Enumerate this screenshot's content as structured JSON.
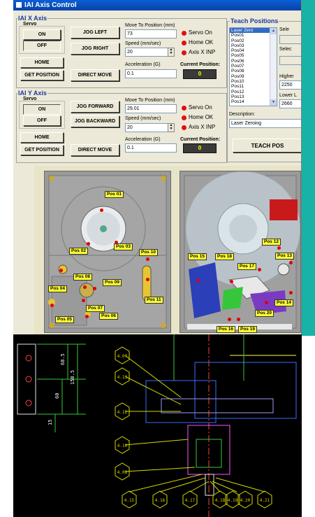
{
  "window": {
    "title": "IAI Axis Control"
  },
  "x_axis": {
    "group_title": "IAI X Axis",
    "servo_label": "Servo",
    "on_label": "ON",
    "off_label": "OFF",
    "home_label": "HOME",
    "get_position_label": "GET POSITION",
    "jog_a_label": "JOG LEFT",
    "jog_b_label": "JOG RIGHT",
    "direct_move_label": "DIRECT MOVE",
    "move_to_label": "Move To Position (mm)",
    "move_to_value": "73",
    "speed_label": "Speed (mm/sec)",
    "speed_value": "20",
    "accel_label": "Acceleration (G)",
    "accel_value": "0.1",
    "servo_on": "Servo On",
    "home_ok": "Home OK",
    "inp": "Axis X INP",
    "current_pos_label": "Current Position:",
    "current_pos_value": "0"
  },
  "y_axis": {
    "group_title": "IAI Y Axis",
    "servo_label": "Servo",
    "on_label": "ON",
    "off_label": "OFF",
    "home_label": "HOME",
    "get_position_label": "GET POSITION",
    "jog_a_label": "JOG FORWARD",
    "jog_b_label": "JOG BACKWARD",
    "direct_move_label": "DIRECT MOVE",
    "move_to_label": "Move To Position (mm)",
    "move_to_value": "29.01",
    "speed_label": "Speed (mm/sec)",
    "speed_value": "20",
    "accel_label": "Acceleration (G)",
    "accel_value": "0.1",
    "servo_on": "Servo On",
    "home_ok": "Home OK",
    "inp": "Axis X INP",
    "current_pos_label": "Current Position:",
    "current_pos_value": "0"
  },
  "teach": {
    "title": "Teach Positions",
    "items": [
      "Laser Zero",
      "Pos01",
      "Pos02",
      "Pos03",
      "Pos04",
      "Pos05",
      "Pos06",
      "Pos07",
      "Pos08",
      "Pos09",
      "Pos10",
      "Pos11",
      "Pos12",
      "Pos13",
      "Pos14"
    ],
    "selected": "Laser Zero",
    "select_label_1": "Sele",
    "select_label_2": "Selec",
    "higher_label": "Higher",
    "higher_value": "2250",
    "lower_label": "Lower L",
    "lower_value": "2660",
    "description_label": "Description:",
    "description_value": "Laser Zeroing",
    "teach_button": "TEACH POS"
  },
  "photo_left_labels": [
    "Pos 01",
    "Pos 02",
    "Pos 03",
    "Pos 04",
    "Pos 05",
    "Pos 06",
    "Pos 07",
    "Pos 08",
    "Pos 09",
    "Pos 10",
    "Pos 11"
  ],
  "photo_right_labels": [
    "Pos 12",
    "Pos 13",
    "Pos 14",
    "Pos 15",
    "Pos 16",
    "Pos 17",
    "Pos 18",
    "Pos 19",
    "Pos 20"
  ],
  "cad": {
    "dims": [
      "68.5",
      "158.5",
      "60",
      "15"
    ],
    "hex_tags": [
      "4.07",
      "4.13",
      "4.12",
      "4.10",
      "4.08",
      "4.15",
      "4.16",
      "4.17",
      "4.18",
      "4.19",
      "4.20",
      "4.21"
    ]
  },
  "colors": {
    "accent": "#1aa39a",
    "title_bar": "#0a5fd6",
    "led": "#e01010",
    "label_yellow": "#ffff33"
  }
}
